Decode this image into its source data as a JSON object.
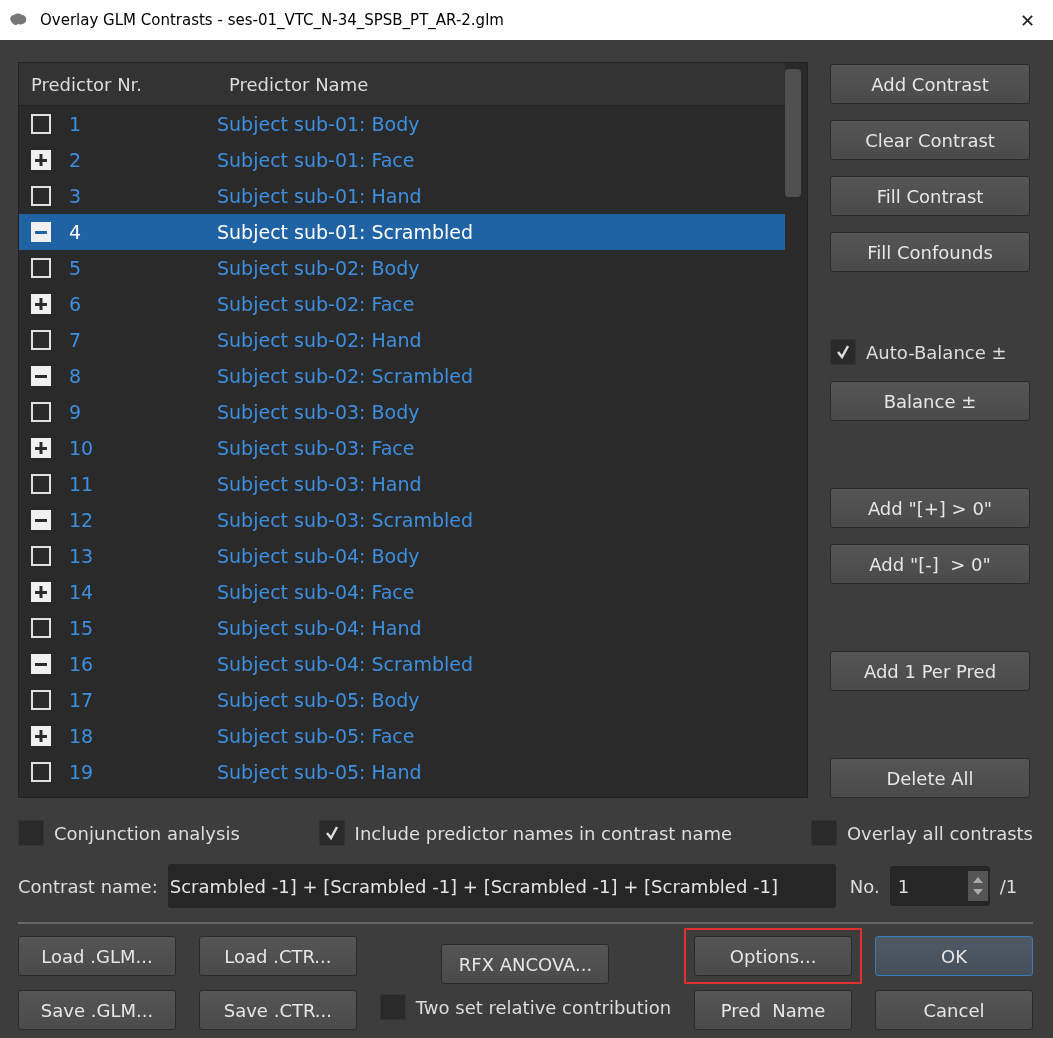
{
  "window": {
    "title": "Overlay GLM Contrasts - ses-01_VTC_N-34_SPSB_PT_AR-2.glm",
    "close": "✕"
  },
  "table": {
    "columns": [
      "Predictor Nr.",
      "Predictor Name"
    ],
    "rows": [
      {
        "nr": "1",
        "name": "Subject sub-01: Body",
        "plus": false,
        "minus": false,
        "selected": false
      },
      {
        "nr": "2",
        "name": "Subject sub-01: Face",
        "plus": true,
        "minus": false,
        "selected": false
      },
      {
        "nr": "3",
        "name": "Subject sub-01: Hand",
        "plus": false,
        "minus": false,
        "selected": false
      },
      {
        "nr": "4",
        "name": "Subject sub-01: Scrambled",
        "plus": false,
        "minus": true,
        "selected": true
      },
      {
        "nr": "5",
        "name": "Subject sub-02: Body",
        "plus": false,
        "minus": false,
        "selected": false
      },
      {
        "nr": "6",
        "name": "Subject sub-02: Face",
        "plus": true,
        "minus": false,
        "selected": false
      },
      {
        "nr": "7",
        "name": "Subject sub-02: Hand",
        "plus": false,
        "minus": false,
        "selected": false
      },
      {
        "nr": "8",
        "name": "Subject sub-02: Scrambled",
        "plus": false,
        "minus": true,
        "selected": false
      },
      {
        "nr": "9",
        "name": "Subject sub-03: Body",
        "plus": false,
        "minus": false,
        "selected": false
      },
      {
        "nr": "10",
        "name": "Subject sub-03: Face",
        "plus": true,
        "minus": false,
        "selected": false
      },
      {
        "nr": "11",
        "name": "Subject sub-03: Hand",
        "plus": false,
        "minus": false,
        "selected": false
      },
      {
        "nr": "12",
        "name": "Subject sub-03: Scrambled",
        "plus": false,
        "minus": true,
        "selected": false
      },
      {
        "nr": "13",
        "name": "Subject sub-04: Body",
        "plus": false,
        "minus": false,
        "selected": false
      },
      {
        "nr": "14",
        "name": "Subject sub-04: Face",
        "plus": true,
        "minus": false,
        "selected": false
      },
      {
        "nr": "15",
        "name": "Subject sub-04: Hand",
        "plus": false,
        "minus": false,
        "selected": false
      },
      {
        "nr": "16",
        "name": "Subject sub-04: Scrambled",
        "plus": false,
        "minus": true,
        "selected": false
      },
      {
        "nr": "17",
        "name": "Subject sub-05: Body",
        "plus": false,
        "minus": false,
        "selected": false
      },
      {
        "nr": "18",
        "name": "Subject sub-05: Face",
        "plus": true,
        "minus": false,
        "selected": false
      },
      {
        "nr": "19",
        "name": "Subject sub-05: Hand",
        "plus": false,
        "minus": false,
        "selected": false
      }
    ]
  },
  "side_panel": [
    [
      {
        "kind": "button",
        "label": "Add Contrast"
      },
      {
        "kind": "button",
        "label": "Clear Contrast"
      },
      {
        "kind": "button",
        "label": "Fill Contrast"
      },
      {
        "kind": "button",
        "label": "Fill Confounds"
      }
    ],
    [
      {
        "kind": "checkbox",
        "label": "Auto-Balance ±",
        "checked": true
      },
      {
        "kind": "button",
        "label": "Balance ±"
      }
    ],
    [
      {
        "kind": "button",
        "label": "Add \"[+] > 0\""
      },
      {
        "kind": "button",
        "label": "Add \"[-]  > 0\""
      }
    ],
    [
      {
        "kind": "button",
        "label": "Add 1 Per Pred"
      }
    ],
    [
      {
        "kind": "button",
        "label": "Delete All"
      }
    ]
  ],
  "options": [
    {
      "label": "Conjunction analysis",
      "checked": false
    },
    {
      "label": "Include predictor names in contrast name",
      "checked": true
    },
    {
      "label": "Overlay all contrasts",
      "checked": false
    }
  ],
  "contrast_name": {
    "label": "Contrast name:",
    "value": "Scrambled -1] + [Scrambled -1] + [Scrambled -1] + [Scrambled -1]",
    "no_label": "No.",
    "no_value": "1",
    "total": "/1"
  },
  "bottom_columns": [
    [
      {
        "kind": "button",
        "label": "Load .GLM...",
        "default": false,
        "highlighted": false
      },
      {
        "kind": "button",
        "label": "Save .GLM...",
        "default": false,
        "highlighted": false
      }
    ],
    [
      {
        "kind": "button",
        "label": "Load .CTR...",
        "default": false,
        "highlighted": false
      },
      {
        "kind": "button",
        "label": "Save .CTR...",
        "default": false,
        "highlighted": false
      }
    ],
    [
      {
        "kind": "button",
        "label": "RFX ANCOVA...",
        "default": false,
        "highlighted": false
      },
      {
        "kind": "checkbox",
        "label": "Two set relative contribution",
        "checked": false
      }
    ],
    [
      {
        "kind": "button",
        "label": "Options...",
        "default": false,
        "highlighted": true
      },
      {
        "kind": "button",
        "label": "Pred  Name",
        "default": false,
        "highlighted": false
      }
    ],
    [
      {
        "kind": "button",
        "label": "OK",
        "default": true,
        "highlighted": false
      },
      {
        "kind": "button",
        "label": "Cancel",
        "default": false,
        "highlighted": false
      }
    ]
  ]
}
